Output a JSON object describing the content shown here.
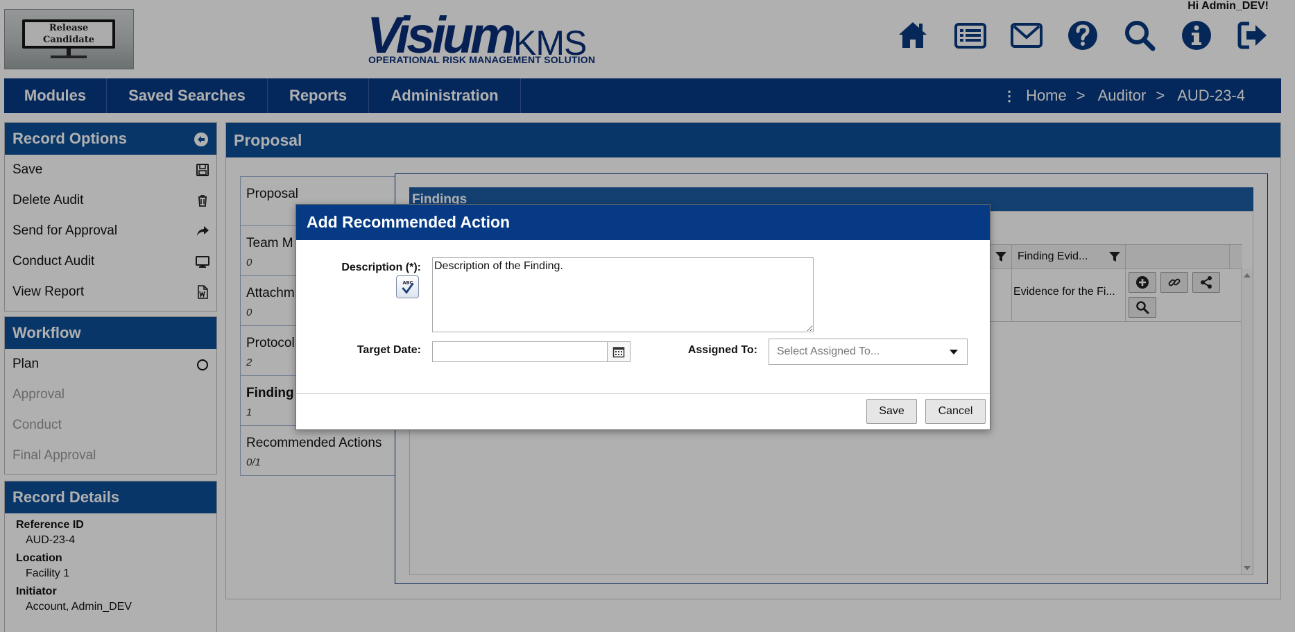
{
  "header": {
    "badge_text": "Release Candidate",
    "logo_main": "Visium",
    "logo_suffix": "KMS",
    "logo_tagline": "OPERATIONAL RISK MANAGEMENT SOLUTION",
    "greeting": "Hi Admin_DEV!",
    "icons": [
      "home-icon",
      "list-icon",
      "mail-icon",
      "help-icon",
      "search-icon",
      "info-icon",
      "logout-icon"
    ]
  },
  "nav": {
    "items": [
      {
        "label": "Modules"
      },
      {
        "label": "Saved Searches"
      },
      {
        "label": "Reports"
      },
      {
        "label": "Administration"
      }
    ],
    "breadcrumb": [
      "Home",
      "Auditor",
      "AUD-23-4"
    ],
    "separator": ">"
  },
  "record_options": {
    "title": "Record Options",
    "items": [
      {
        "label": "Save",
        "icon": "floppy-disk-icon"
      },
      {
        "label": "Delete Audit",
        "icon": "trash-icon"
      },
      {
        "label": "Send for Approval",
        "icon": "share-arrow-icon"
      },
      {
        "label": "Conduct Audit",
        "icon": "monitor-icon"
      },
      {
        "label": "View Report",
        "icon": "word-document-icon"
      }
    ]
  },
  "workflow": {
    "title": "Workflow",
    "steps": [
      {
        "label": "Plan",
        "active": true
      },
      {
        "label": "Approval",
        "active": false
      },
      {
        "label": "Conduct",
        "active": false
      },
      {
        "label": "Final Approval",
        "active": false
      }
    ]
  },
  "record_details": {
    "title": "Record Details",
    "fields": [
      {
        "label": "Reference ID",
        "value": "AUD-23-4"
      },
      {
        "label": "Location",
        "value": "Facility 1"
      },
      {
        "label": "Initiator",
        "value": "Account, Admin_DEV"
      }
    ]
  },
  "main": {
    "title": "Proposal",
    "tabs": [
      {
        "label": "Proposal",
        "count": ""
      },
      {
        "label": "Team M",
        "count": "0"
      },
      {
        "label": "Attachm",
        "count": "0"
      },
      {
        "label": "Protocol",
        "count": "2"
      },
      {
        "label": "Finding",
        "count": "1"
      },
      {
        "label": "Recommended Actions",
        "count": "0/1"
      }
    ],
    "findings": {
      "title": "Findings",
      "columns": [
        "Finding Evid..."
      ],
      "rows": [
        {
          "evidence": "Evidence for the Fi..."
        }
      ]
    }
  },
  "modal": {
    "title": "Add Recommended Action",
    "description_label": "Description (*):",
    "description_value": "Description of the Finding.",
    "target_date_label": "Target Date:",
    "target_date_value": "",
    "assigned_to_label": "Assigned To:",
    "assigned_to_placeholder": "Select Assigned To...",
    "save_label": "Save",
    "cancel_label": "Cancel"
  }
}
